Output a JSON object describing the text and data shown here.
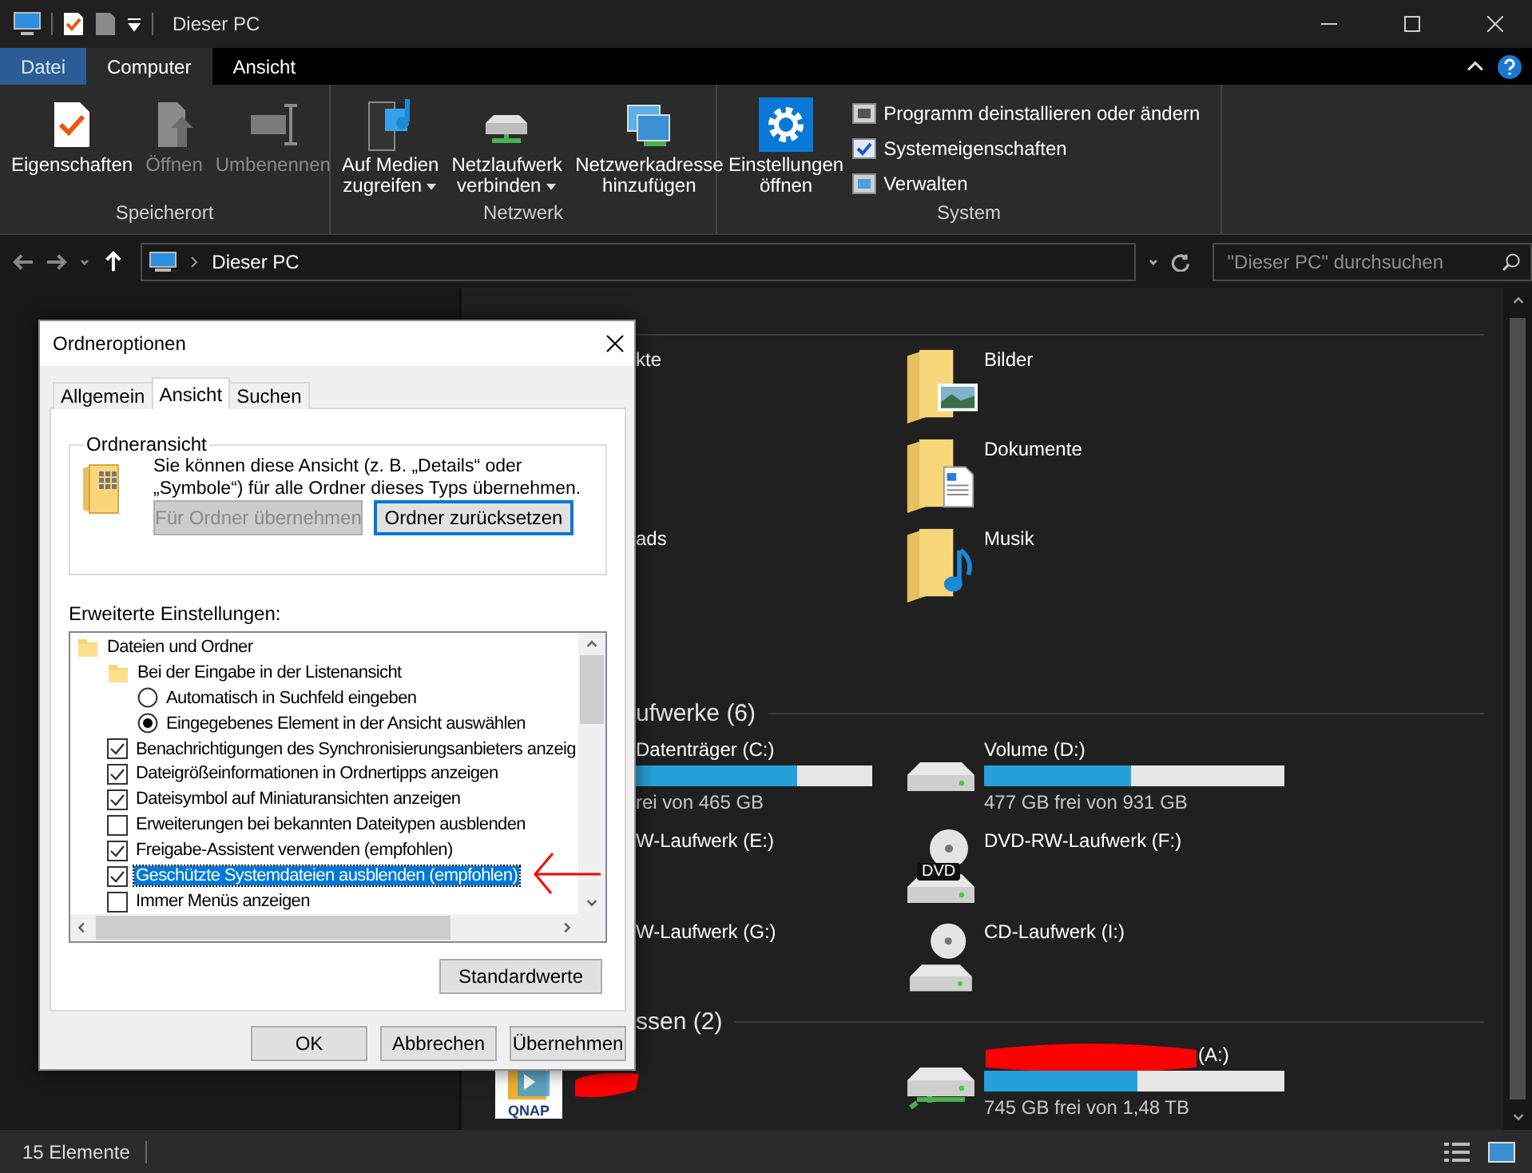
{
  "window": {
    "title": "Dieser PC"
  },
  "ribbon": {
    "tabs": [
      {
        "label": "Datei",
        "kind": "file",
        "selected": false
      },
      {
        "label": "Computer",
        "kind": "tab",
        "selected": true
      },
      {
        "label": "Ansicht",
        "kind": "tab",
        "selected": false
      }
    ],
    "groups": [
      {
        "label": "Speicherort",
        "buttons": [
          {
            "lines": [
              "Eigenschaften"
            ],
            "disabled": false,
            "dropdown": false
          },
          {
            "lines": [
              "Öffnen"
            ],
            "disabled": true,
            "dropdown": false
          },
          {
            "lines": [
              "Umbenennen"
            ],
            "disabled": true,
            "dropdown": false
          }
        ]
      },
      {
        "label": "Netzwerk",
        "buttons": [
          {
            "lines": [
              "Auf Medien",
              "zugreifen"
            ],
            "disabled": false,
            "dropdown": true
          },
          {
            "lines": [
              "Netzlaufwerk",
              "verbinden"
            ],
            "disabled": false,
            "dropdown": true
          },
          {
            "lines": [
              "Netzwerkadresse",
              "hinzufügen"
            ],
            "disabled": false,
            "dropdown": false
          }
        ]
      },
      {
        "label": "System",
        "buttons": [
          {
            "lines": [
              "Einstellungen",
              "öffnen"
            ],
            "disabled": false,
            "dropdown": false
          }
        ],
        "small_buttons": [
          "Programm deinstallieren oder ändern",
          "Systemeigenschaften",
          "Verwalten"
        ]
      }
    ]
  },
  "address_bar": {
    "path": "Dieser PC"
  },
  "search": {
    "placeholder": "\"Dieser PC\" durchsuchen"
  },
  "content": {
    "folder_rows": [
      {
        "left": {
          "name": "kte"
        },
        "right": {
          "kind": "pictures",
          "name": "Bilder"
        }
      },
      {
        "right": {
          "kind": "documents",
          "name": "Dokumente"
        }
      },
      {
        "left": {
          "name": "ads"
        },
        "right": {
          "kind": "music",
          "name": "Musik"
        }
      }
    ],
    "drives_heading": "ufwerke (6)",
    "drive_rows": [
      {
        "left": {
          "name": "Datenträger (C:)",
          "level": 0.68,
          "free": "rei von 465 GB"
        },
        "right": {
          "kind": "hdd",
          "name": "Volume (D:)",
          "level": 0.49,
          "free": "477 GB frei von 931 GB"
        }
      },
      {
        "left": {
          "name": "W-Laufwerk (E:)"
        },
        "right": {
          "kind": "dvd",
          "badge": "DVD",
          "name": "DVD-RW-Laufwerk (F:)"
        }
      },
      {
        "left": {
          "name": "W-Laufwerk (G:)"
        },
        "right": {
          "kind": "cd",
          "name": "CD-Laufwerk (I:)"
        }
      }
    ],
    "network_heading": "ssen (2)",
    "network_rows": [
      {
        "left": {
          "kind": "nas-app",
          "badge": "QNAP"
        },
        "right": {
          "kind": "network",
          "redacted": true,
          "name": "(A:)",
          "level": 0.51,
          "free": "745 GB frei von 1,48 TB"
        }
      }
    ]
  },
  "status_bar": {
    "count": "15 Elemente"
  },
  "dialog": {
    "title": "Ordneroptionen",
    "tabs": [
      {
        "label": "Allgemein",
        "selected": false
      },
      {
        "label": "Ansicht",
        "selected": true
      },
      {
        "label": "Suchen",
        "selected": false
      }
    ],
    "group_title": "Ordneransicht",
    "description": "Sie können diese Ansicht (z. B. „Details“ oder „Symbole“) für alle Ordner dieses Typs übernehmen.",
    "group_buttons": [
      {
        "label": "Für Ordner übernehmen",
        "disabled": true,
        "focused": false
      },
      {
        "label": "Ordner zurücksetzen",
        "disabled": false,
        "focused": true
      }
    ],
    "settings_label": "Erweiterte Einstellungen:",
    "settings": [
      {
        "kind": "folder",
        "label": "Dateien und Ordner",
        "children": [
          {
            "kind": "folder",
            "label": "Bei der Eingabe in der Listenansicht",
            "children": [
              {
                "kind": "radio",
                "label": "Automatisch in Suchfeld eingeben",
                "checked": false,
                "selected": false
              },
              {
                "kind": "radio",
                "label": "Eingegebenes Element in der Ansicht auswählen",
                "checked": true,
                "selected": false
              }
            ]
          },
          {
            "kind": "checkbox",
            "label": "Benachrichtigungen des Synchronisierungsanbieters anzeig",
            "checked": true,
            "selected": false
          },
          {
            "kind": "checkbox",
            "label": "Dateigrößeinformationen in Ordnertipps anzeigen",
            "checked": true,
            "selected": false
          },
          {
            "kind": "checkbox",
            "label": "Dateisymbol auf Miniaturansichten anzeigen",
            "checked": true,
            "selected": false
          },
          {
            "kind": "checkbox",
            "label": "Erweiterungen bei bekannten Dateitypen ausblenden",
            "checked": false,
            "selected": false
          },
          {
            "kind": "checkbox",
            "label": "Freigabe-Assistent verwenden (empfohlen)",
            "checked": true,
            "selected": false
          },
          {
            "kind": "checkbox",
            "label": "Geschützte Systemdateien ausblenden (empfohlen)",
            "checked": true,
            "selected": true
          },
          {
            "kind": "checkbox",
            "label": "Immer Menüs anzeigen",
            "checked": false,
            "selected": false
          }
        ]
      }
    ],
    "defaults_button": "Standardwerte",
    "buttons": [
      "OK",
      "Abbrechen",
      "Übernehmen"
    ]
  }
}
